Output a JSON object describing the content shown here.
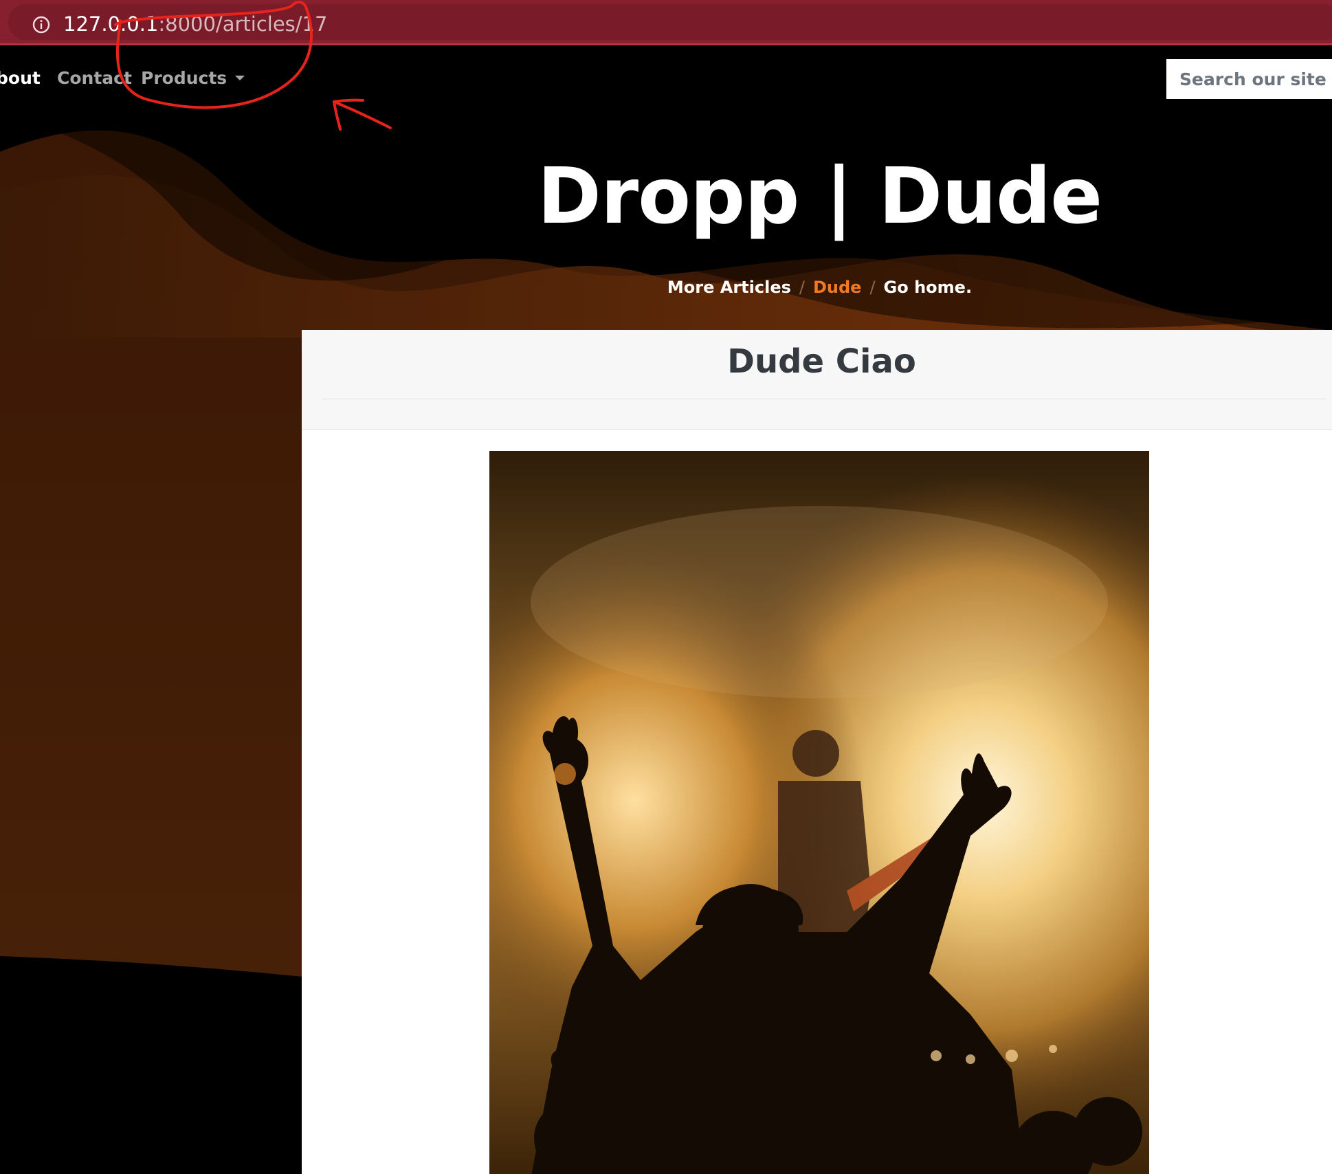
{
  "browser": {
    "url_host": "127.0.0.1",
    "url_path": ":8000/articles/17",
    "info_icon": "info-icon"
  },
  "navbar": {
    "about_label": "bout",
    "contact_label": "Contact",
    "products_label": "Products",
    "search_placeholder": "Search our site"
  },
  "hero": {
    "title": "Dropp | Dude",
    "breadcrumb": {
      "more_articles": "More Articles",
      "active": "Dude",
      "home": "Go home.",
      "separator": "/"
    }
  },
  "article": {
    "title": "Dude Ciao",
    "image": "concert-photo"
  },
  "colors": {
    "browser_bar": "#861f2e",
    "accent_orange": "#f07a22",
    "annotation_red": "#e8231b"
  }
}
